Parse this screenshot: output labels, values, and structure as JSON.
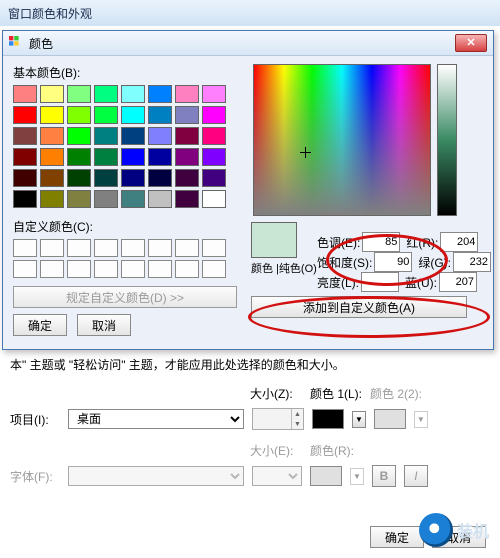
{
  "outer": {
    "title": "窗口颜色和外观"
  },
  "dialog": {
    "title": "颜色",
    "close_glyph": "✕",
    "basic_label": "基本颜色(B):",
    "custom_label": "自定义颜色(C):",
    "define_btn": "规定自定义颜色(D) >>",
    "ok": "确定",
    "cancel": "取消",
    "preview_label": "颜色 |纯色(O)",
    "hsl": {
      "hue_label": "色调(E):",
      "hue": "85",
      "sat_label": "饱和度(S):",
      "sat": "90",
      "lum_label": "亮度(L):",
      "lum": ""
    },
    "rgb": {
      "r_label": "红(R):",
      "r": "204",
      "g_label": "绿(G):",
      "g": "232",
      "b_label": "蓝(U):",
      "b": "207"
    },
    "add_btn": "添加到自定义颜色(A)",
    "basic_colors": [
      "#ff8080",
      "#ffff80",
      "#80ff80",
      "#00ff80",
      "#80ffff",
      "#0080ff",
      "#ff80c0",
      "#ff80ff",
      "#ff0000",
      "#ffff00",
      "#80ff00",
      "#00ff40",
      "#00ffff",
      "#0080c0",
      "#8080c0",
      "#ff00ff",
      "#804040",
      "#ff8040",
      "#00ff00",
      "#008080",
      "#004080",
      "#8080ff",
      "#800040",
      "#ff0080",
      "#800000",
      "#ff8000",
      "#008000",
      "#008040",
      "#0000ff",
      "#0000a0",
      "#800080",
      "#8000ff",
      "#400000",
      "#804000",
      "#004000",
      "#004040",
      "#000080",
      "#000040",
      "#400040",
      "#400080",
      "#000000",
      "#808000",
      "#808040",
      "#808080",
      "#408080",
      "#c0c0c0",
      "#400040",
      "#ffffff"
    ]
  },
  "lower": {
    "hint": "本\" 主题或 \"轻松访问\" 主题，才能应用此处选择的颜色和大小。",
    "item_label": "项目(I):",
    "item_value": "桌面",
    "size_label": "大小(Z):",
    "color1_label": "颜色 1(L):",
    "color2_label": "颜色 2(2):",
    "font_label": "字体(F):",
    "fsize_label": "大小(E):",
    "fcolor_label": "颜色(R):",
    "ok": "确定",
    "cancel": "取消"
  },
  "watermark": "装机"
}
